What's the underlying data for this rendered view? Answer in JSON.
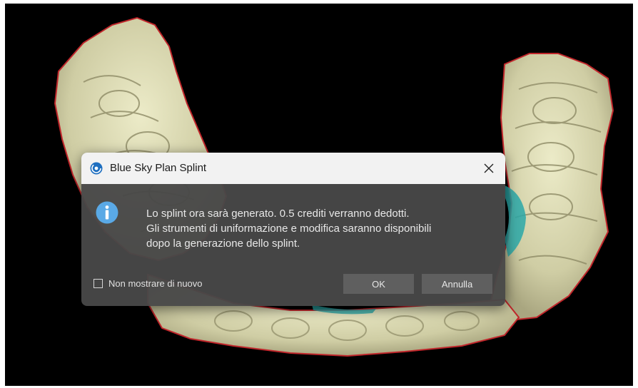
{
  "dialog": {
    "title": "Blue Sky Plan Splint",
    "message_lines": [
      "Lo splint ora sarà generato. 0.5 crediti verranno dedotti.",
      "Gli strumenti di uniformazione e modifica saranno disponibili",
      "dopo la generazione dello splint."
    ],
    "checkbox_label": "Non mostrare di nuovo",
    "checkbox_checked": false,
    "ok_label": "OK",
    "cancel_label": "Annulla",
    "icons": {
      "app": "blue-sky-plan-swirl-icon",
      "info": "info-icon",
      "close": "close-icon"
    }
  },
  "colors": {
    "viewport_background": "#000000",
    "dental_model": "#d8d6b0",
    "model_outline": "#c0262b",
    "selection_teal": "#2aa8a8",
    "dialog_background": "#484848",
    "titlebar_background": "#f2f2f2",
    "info_blue": "#5aa9e6",
    "button_background": "#5f5f5f"
  }
}
